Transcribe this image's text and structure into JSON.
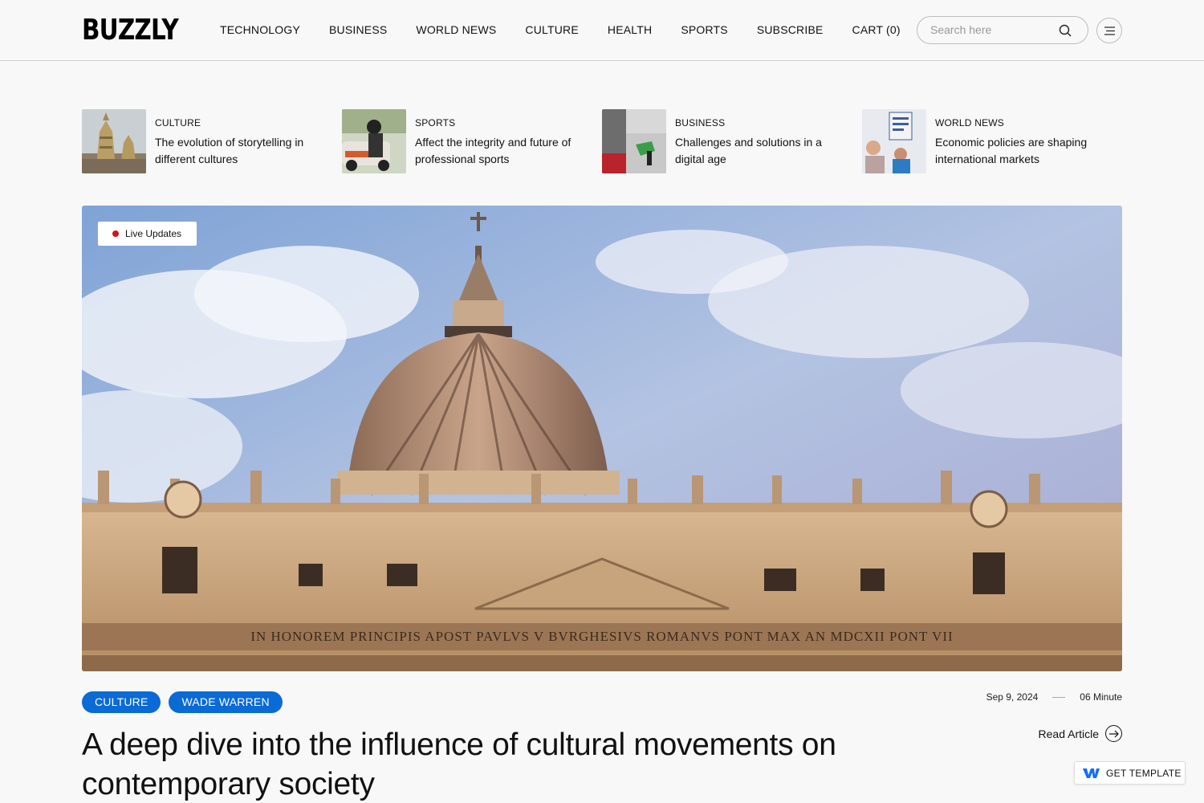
{
  "header": {
    "logo": "BUZZLY",
    "nav": [
      "TECHNOLOGY",
      "BUSINESS",
      "WORLD NEWS",
      "CULTURE",
      "HEALTH",
      "SPORTS",
      "SUBSCRIBE",
      "CART (0)"
    ],
    "search_placeholder": "Search here",
    "search_icon": "search-icon",
    "menu_icon": "hamburger-menu-icon"
  },
  "stories": [
    {
      "category": "CULTURE",
      "title": "The evolution of storytelling in different cultures",
      "image": "temple-photo"
    },
    {
      "category": "SPORTS",
      "title": "Affect the integrity and future of professional sports",
      "image": "motorsport-photo"
    },
    {
      "category": "BUSINESS",
      "title": "Challenges and solutions in a digital age",
      "image": "fuel-pump-photo"
    },
    {
      "category": "WORLD NEWS",
      "title": "Economic policies are shaping international markets",
      "image": "protest-photo"
    }
  ],
  "hero": {
    "badge": "Live Updates",
    "image": "basilica-dome-photo",
    "inscription": "IN HONOREM PRINCIPIS APOST PAVLVS V BVRGHESIVS ROMANVS PONT MAX AN MDCXII PONT VII"
  },
  "article": {
    "tags": [
      "CULTURE",
      "WADE WARREN"
    ],
    "date": "Sep 9, 2024",
    "read_time": "06 Minute",
    "headline": "A deep dive into the influence of cultural movements on contemporary society",
    "read_label": "Read Article"
  },
  "get_template": {
    "label": "GET TEMPLATE",
    "icon": "webflow-logo-icon"
  },
  "colors": {
    "accent": "#0a6ad6",
    "live_dot": "#d4131a",
    "background": "#f8f8f8"
  }
}
